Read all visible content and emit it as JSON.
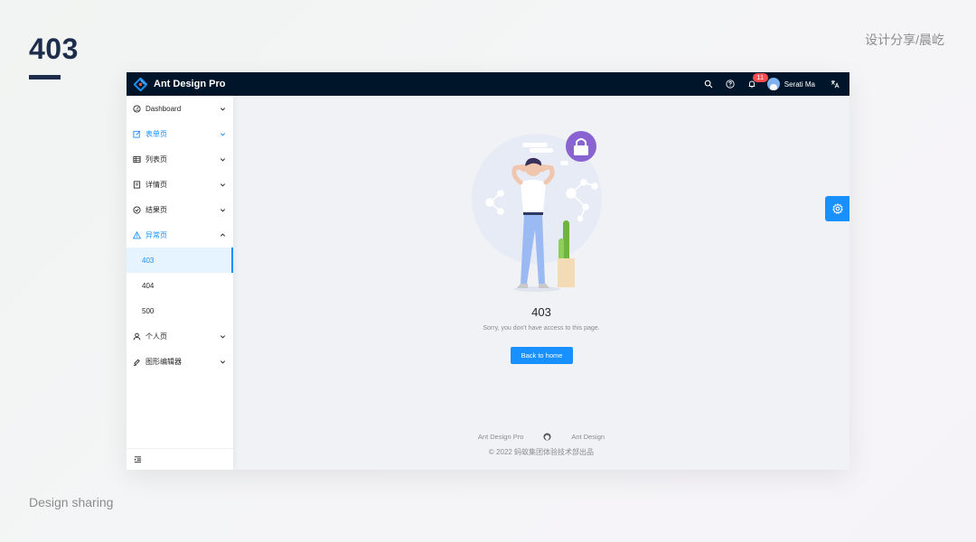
{
  "slide": {
    "title": "403",
    "credit": "设计分享/晨屹",
    "footer": "Design sharing"
  },
  "app": {
    "brand": "Ant Design Pro",
    "header": {
      "notification_count": "11",
      "user_name": "Serati Ma",
      "icons": [
        "search-icon",
        "question-icon",
        "bell-icon",
        "translate-icon"
      ]
    },
    "sidebar": {
      "items": [
        {
          "label": "Dashboard",
          "icon": "dashboard-icon",
          "state": "collapsed"
        },
        {
          "label": "表单页",
          "icon": "form-icon",
          "state": "collapsed",
          "highlight": true
        },
        {
          "label": "列表页",
          "icon": "table-icon",
          "state": "collapsed"
        },
        {
          "label": "详情页",
          "icon": "profile-icon",
          "state": "collapsed"
        },
        {
          "label": "结果页",
          "icon": "check-circle-icon",
          "state": "collapsed"
        },
        {
          "label": "异常页",
          "icon": "warning-icon",
          "state": "open",
          "children": [
            {
              "label": "403",
              "selected": true
            },
            {
              "label": "404"
            },
            {
              "label": "500"
            }
          ]
        },
        {
          "label": "个人页",
          "icon": "user-icon",
          "state": "collapsed"
        },
        {
          "label": "图形编辑器",
          "icon": "highlight-icon",
          "state": "collapsed"
        }
      ]
    },
    "result": {
      "title": "403",
      "subtitle": "Sorry, you don't have access to this page.",
      "button": "Back to home"
    },
    "footer": {
      "link1": "Ant Design Pro",
      "link2": "Ant Design",
      "copyright": "© 2022 蚂蚁集团体验技术部出品"
    },
    "colors": {
      "header_bg": "#001529",
      "primary": "#1890ff",
      "badge": "#ff4d4f",
      "lock_circle": "#8a63d2"
    }
  }
}
